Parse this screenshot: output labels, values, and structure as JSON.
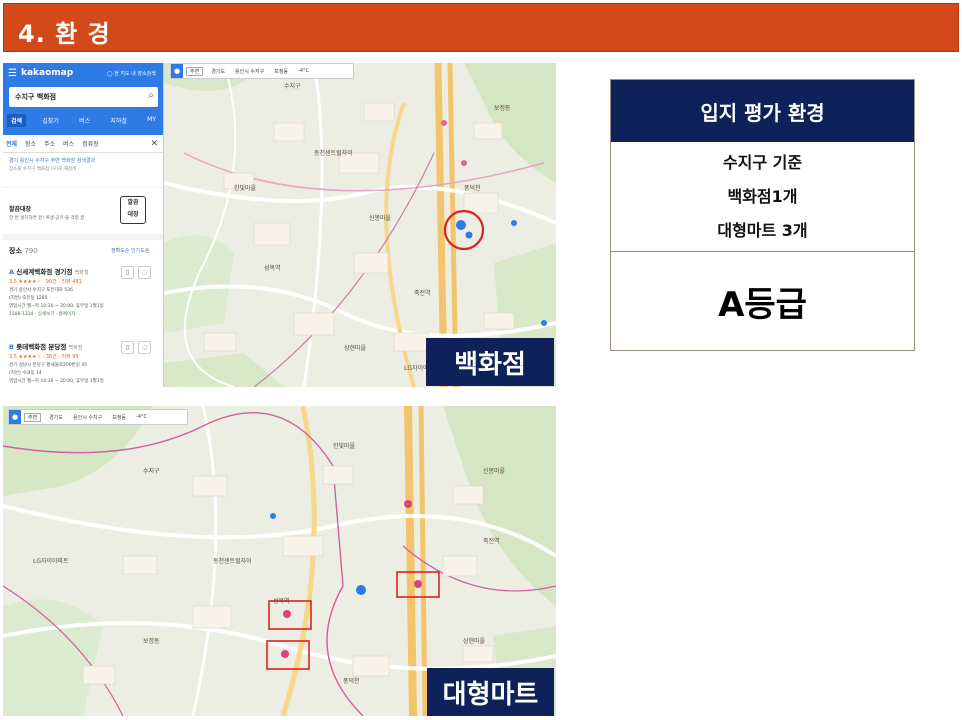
{
  "header": {
    "title": "4. 환 경"
  },
  "sidebar": {
    "menu_icon": "menu-icon",
    "logo": "kakaomap",
    "hint": "◯ 현 지도 내 장소검색",
    "search_value": "수지구 백화점",
    "tabs": [
      "검색",
      "길찾기",
      "버스",
      "지하철",
      "MY"
    ],
    "subtabs": [
      "전체",
      "장소",
      "주소",
      "버스",
      "정류장"
    ],
    "note": "경기 용인시 수지구 주변 백화점 검색결과",
    "note2": "장소를 수지구 백화점 (으)로 재검색 ›",
    "ad_title": "깔끔대장",
    "ad_desc": "한 번 설치하면 끝! 위생·공기·물 걱정 끝",
    "ad_logo": "깔끔\n대장",
    "count_label": "장소",
    "count_value": "790",
    "sort_label": "정확도순  인기도순",
    "places": [
      {
        "index": "A",
        "name": "신세계백화점 경기점",
        "category": "백화점",
        "rating": "3.5 ★★★★☆ · 90건  · 리뷰 481",
        "address": "경기 용인시 수지구 포은대로 536",
        "address2": "(지번) 죽전동 1285",
        "hours": "영업시간 월~목 10:30 ~ 20:00, 휴무일 1월1일",
        "phone": "1588-1234 · 상세보기 · 홈페이지"
      },
      {
        "index": "B",
        "name": "롯데백화점 분당점",
        "category": "백화점",
        "rating": "3.5 ★★★★☆ · 36건  · 리뷰 95",
        "address": "경기 성남시 분당구 황새울로200번길 45",
        "address2": "(지번) 수내동 14",
        "hours": "영업시간 월~목 10:30 ~ 20:00, 휴무일 1월1일",
        "phone": ""
      }
    ]
  },
  "breadcrumb": {
    "chip": "주변",
    "items": [
      "경기도",
      "용인시 수지구",
      "보정동"
    ],
    "weather": "-4°C"
  },
  "map1_label": "백화점",
  "map2_label": "대형마트",
  "map_labels": [
    "수지구",
    "동천센트럴자이",
    "한빛마을",
    "신봉마을",
    "성복역",
    "죽전역",
    "보정동",
    "풍덕천",
    "상현마을",
    "LG자이아파트"
  ],
  "panel": {
    "title": "입지 평가 환경",
    "line1": "수지구 기준",
    "line2": "백화점1개",
    "line3": "대형마트 3개",
    "grade": "A등급"
  },
  "colors": {
    "header_bg": "#d24a1a",
    "navy": "#0e2259",
    "kakao_blue": "#2e7be6",
    "marker_red": "#e02020"
  }
}
